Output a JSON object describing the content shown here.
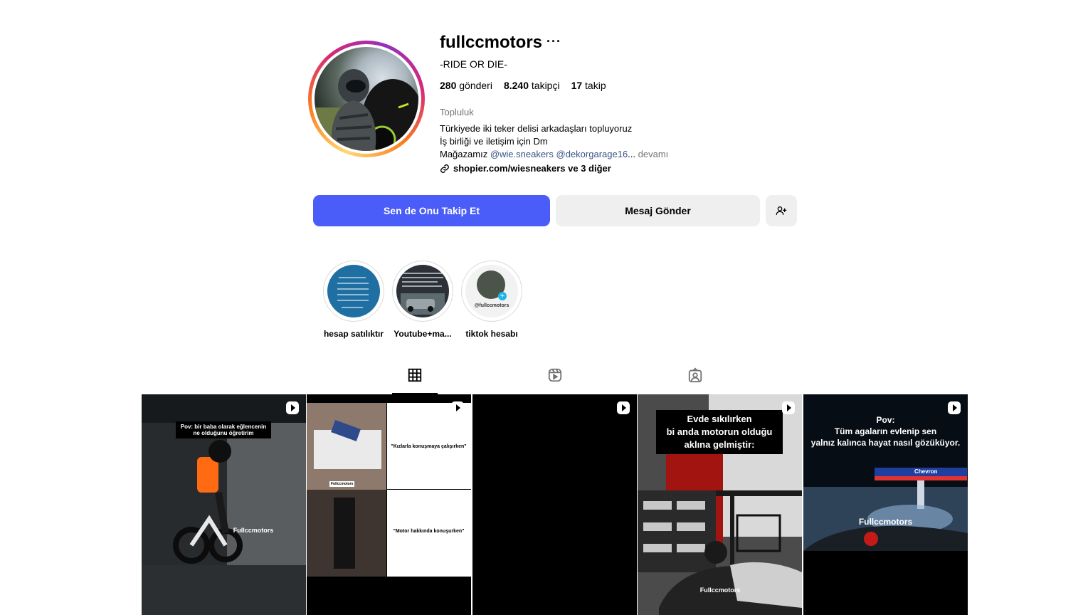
{
  "profile": {
    "username": "fullccmotors",
    "more_icon": "more-options-icon",
    "full_name": "-RIDE OR DIE-",
    "stats": {
      "posts_count": "280",
      "posts_label": "gönderi",
      "followers_count": "8.240",
      "followers_label": "takipçi",
      "following_count": "17",
      "following_label": "takip"
    },
    "category": "Topluluk",
    "bio_line1": "Türkiyede iki teker delisi arkadaşları topluyoruz",
    "bio_line2": "İş birliği ve iletişim için Dm",
    "bio_line3_prefix": "Mağazamız ",
    "bio_mention1": "@wie.sneakers",
    "bio_mention2": "@dekorgarage16",
    "bio_ellipsis": "...",
    "bio_more": "devamı",
    "link_text": "shopier.com/wiesneakers ve 3 diğer"
  },
  "actions": {
    "follow_label": "Sen de Onu Takip Et",
    "message_label": "Mesaj Gönder"
  },
  "highlights": [
    {
      "label": "hesap satılıktır"
    },
    {
      "label": "Youtube+ma..."
    },
    {
      "label": "tiktok hesabı",
      "inner_text": "@fullccmotors"
    }
  ],
  "tabs": [
    "grid-icon",
    "reels-icon",
    "tagged-icon"
  ],
  "posts": [
    {
      "caption_line1": "Pov: bir baba olarak eğlencenin",
      "caption_line2": "ne olduğunu öğretirim",
      "watermark": "Fullccmotors"
    },
    {
      "watermark": "Fullccmotors",
      "text_top": "\"Kızlarla konuşmaya çalışırken\"",
      "text_bottom": "\"Motor hakkında konuşurken\""
    },
    {},
    {
      "caption_line1": "Evde sıkılırken",
      "caption_line2": "bi anda motorun olduğu",
      "caption_line3": "aklına gelmiştir:",
      "watermark": "Fullccmotors"
    },
    {
      "caption_line1": "Pov:",
      "caption_line2": "Tüm agaların evlenip sen",
      "caption_line3": "yalnız kalınca hayat nasıl gözüküyor.",
      "watermark": "Fullccmotors",
      "sign": "Chevron"
    }
  ],
  "colors": {
    "follow_button": "#4a5df9",
    "secondary_button": "#efefef",
    "mention": "#385185",
    "muted": "#737373"
  }
}
